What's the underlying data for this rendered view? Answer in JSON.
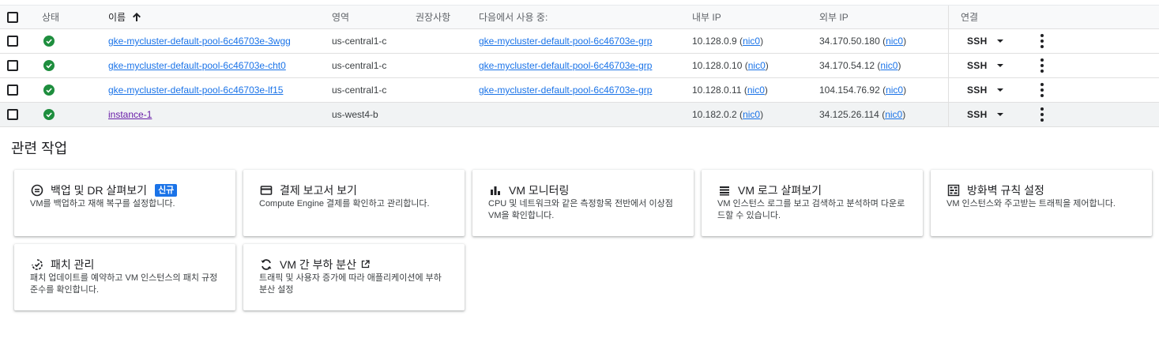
{
  "table": {
    "headers": {
      "status": "상태",
      "name": "이름",
      "zone": "영역",
      "recommendation": "권장사항",
      "used_by": "다음에서 사용 중:",
      "internal_ip": "내부 IP",
      "external_ip": "외부 IP",
      "connect": "연결"
    },
    "sort": "ascending",
    "rows": [
      {
        "name": "gke-mycluster-default-pool-6c46703e-3wgg",
        "zone": "us-central1-c",
        "used_by": "gke-mycluster-default-pool-6c46703e-grp",
        "internal_ip": "10.128.0.9",
        "internal_nic": "nic0",
        "external_ip": "34.170.50.180",
        "external_nic": "nic0",
        "ssh": "SSH"
      },
      {
        "name": "gke-mycluster-default-pool-6c46703e-cht0",
        "zone": "us-central1-c",
        "used_by": "gke-mycluster-default-pool-6c46703e-grp",
        "internal_ip": "10.128.0.10",
        "internal_nic": "nic0",
        "external_ip": "34.170.54.12",
        "external_nic": "nic0",
        "ssh": "SSH"
      },
      {
        "name": "gke-mycluster-default-pool-6c46703e-lf15",
        "zone": "us-central1-c",
        "used_by": "gke-mycluster-default-pool-6c46703e-grp",
        "internal_ip": "10.128.0.11",
        "internal_nic": "nic0",
        "external_ip": "104.154.76.92",
        "external_nic": "nic0",
        "ssh": "SSH"
      },
      {
        "name": "instance-1",
        "zone": "us-west4-b",
        "used_by": "",
        "internal_ip": "10.182.0.2",
        "internal_nic": "nic0",
        "external_ip": "34.125.26.114",
        "external_nic": "nic0",
        "ssh": "SSH"
      }
    ]
  },
  "related": {
    "title": "관련 작업",
    "cards": [
      {
        "icon": "backup-icon",
        "title": "백업 및 DR 살펴보기",
        "badge": "신규",
        "desc": "VM를 백업하고 재해 복구를 설정합니다."
      },
      {
        "icon": "billing-icon",
        "title": "결제 보고서 보기",
        "desc": "Compute Engine 결제를 확인하고 관리합니다."
      },
      {
        "icon": "bar-chart-icon",
        "title": "VM 모니터링",
        "desc": "CPU 및 네트워크와 같은 측정항목 전반에서 이상점 VM을 확인합니다."
      },
      {
        "icon": "logs-icon",
        "title": "VM 로그 살펴보기",
        "desc": "VM 인스턴스 로그를 보고 검색하고 분석하며 다운로드할 수 있습니다."
      },
      {
        "icon": "firewall-icon",
        "title": "방화벽 규칙 설정",
        "desc": "VM 인스턴스와 주고받는 트래픽을 제어합니다."
      },
      {
        "icon": "patch-icon",
        "title": "패치 관리",
        "desc": "패치 업데이트를 예약하고 VM 인스턴스의 패치 규정 준수를 확인합니다."
      },
      {
        "icon": "load-balance-icon",
        "title": "VM 간 부하 분산",
        "desc": "트래픽 및 사용자 증가에 따라 애플리케이션에 부하 분산 설정",
        "external": true
      }
    ]
  },
  "colors": {
    "link": "#1a73e8",
    "visited_link": "#681da8",
    "status_ok": "#1e8e3e",
    "badge": "#1a73e8"
  }
}
